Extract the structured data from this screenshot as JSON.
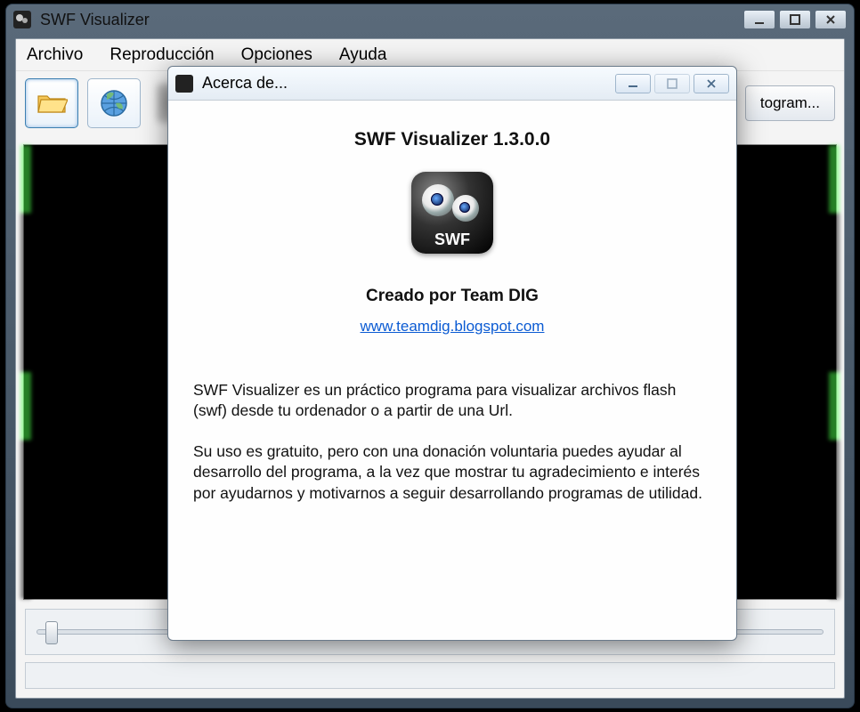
{
  "window": {
    "title": "SWF Visualizer"
  },
  "menu": {
    "file": "Archivo",
    "playback": "Reproducción",
    "options": "Opciones",
    "help": "Ayuda"
  },
  "toolbar": {
    "frame_button": "togram..."
  },
  "about": {
    "title": "Acerca de...",
    "heading": "SWF Visualizer 1.3.0.0",
    "icon_label": "SWF",
    "creator": "Creado por Team DIG",
    "link": "www.teamdig.blogspot.com",
    "para1": "SWF Visualizer es un práctico programa para visualizar archivos flash (swf) desde tu ordenador o a partir de una Url.",
    "para2": "Su uso es gratuito, pero con una donación voluntaria puedes ayudar al desarrollo del programa, a la vez que mostrar tu agradecimiento e interés por ayudarnos y motivarnos a seguir desarrollando programas de utilidad."
  }
}
